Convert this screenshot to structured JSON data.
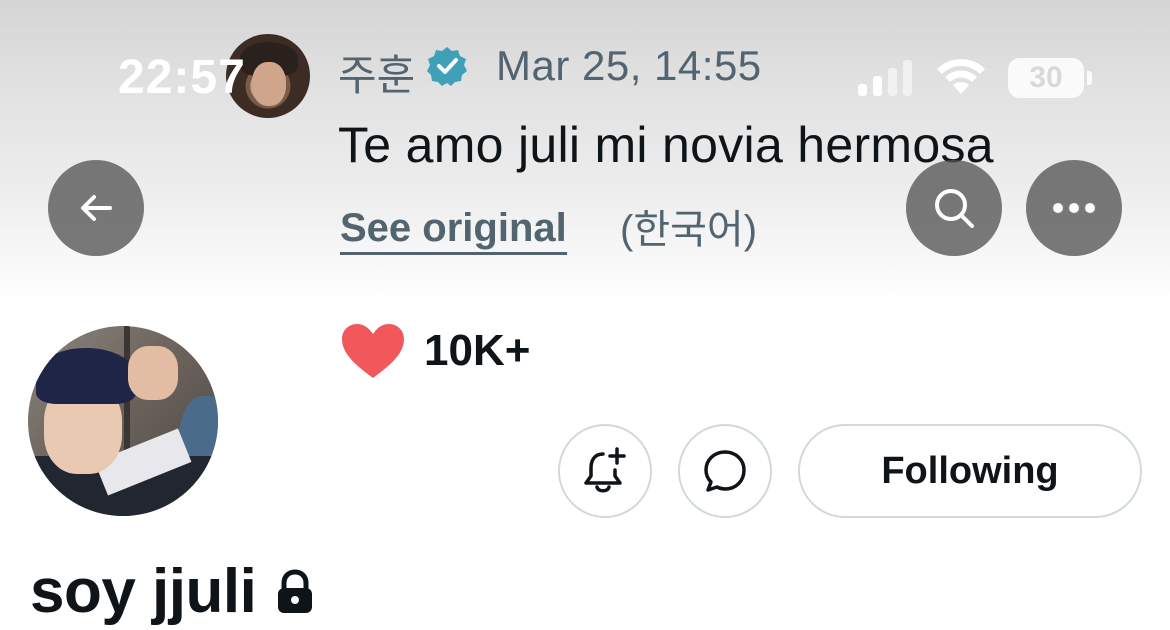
{
  "status_bar": {
    "time": "22:57",
    "battery": "30"
  },
  "post": {
    "author_name": "주훈",
    "date": "Mar 25, 14:55",
    "text": "Te amo juli mi novia hermosa",
    "see_original_label": "See original",
    "language": "(한국어)",
    "like_count": "10K+"
  },
  "profile": {
    "display_name": "soy jjuli",
    "follow_button_label": "Following"
  },
  "colors": {
    "like": "#f0585b",
    "verified": "#3fa0b8",
    "secondary_text": "#536471",
    "primary_text": "#0f1419",
    "border": "#cfd9de"
  },
  "icons": [
    "back-arrow-icon",
    "search-icon",
    "more-icon",
    "verified-badge-icon",
    "heart-icon",
    "bell-plus-icon",
    "message-icon",
    "lock-icon",
    "signal-icon",
    "wifi-icon"
  ]
}
